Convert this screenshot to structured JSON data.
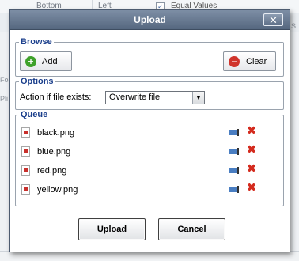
{
  "background": {
    "cells": [
      "Bottom",
      "Left"
    ],
    "checkbox_label": "Equal Values",
    "hints": [
      "S",
      "Fol",
      "Pli"
    ]
  },
  "dialog": {
    "title": "Upload",
    "close_glyph": "✕"
  },
  "browse": {
    "legend": "Browse",
    "add_label": "Add",
    "clear_label": "Clear"
  },
  "options": {
    "legend": "Options",
    "label": "Action if file exists:",
    "selected": "Overwrite file"
  },
  "queue": {
    "legend": "Queue",
    "files": [
      "black.png",
      "blue.png",
      "red.png",
      "yellow.png"
    ]
  },
  "actions": {
    "upload_label": "Upload",
    "cancel_label": "Cancel"
  },
  "colors": {
    "legend": "#1b3f8c",
    "remove": "#d42b1e",
    "add_icon": "#3ea12a",
    "clear_icon": "#d0342c"
  }
}
